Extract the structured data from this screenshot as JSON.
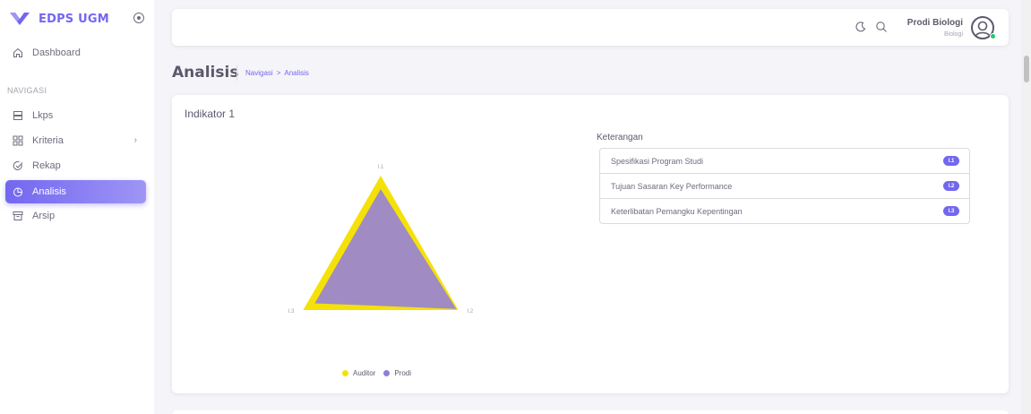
{
  "brand": {
    "name": "EDPS UGM",
    "accent": "#7367f0"
  },
  "sidebar": {
    "top_items": [
      {
        "label": "Dashboard",
        "icon": "home-icon"
      }
    ],
    "nav_heading": "NAVIGASI",
    "items": [
      {
        "label": "Lkps",
        "icon": "list-icon"
      },
      {
        "label": "Kriteria",
        "icon": "grid-icon",
        "has_submenu": true
      },
      {
        "label": "Rekap",
        "icon": "check-circle-icon"
      },
      {
        "label": "Analisis",
        "icon": "pie-chart-icon",
        "active": true
      },
      {
        "label": "Arsip",
        "icon": "archive-icon"
      }
    ]
  },
  "navbar": {
    "icons": [
      "moon-icon",
      "search-icon"
    ],
    "user_name": "Prodi Biologi",
    "user_role": "Biologi",
    "status_color": "#28c76f"
  },
  "page": {
    "title": "Analisis",
    "breadcrumb": [
      "Navigasi",
      ">",
      "Analisis"
    ]
  },
  "card": {
    "title": "Indikator 1",
    "keterangan_title": "Keterangan",
    "keterangan": [
      {
        "label": "Spesifikasi Program Studi",
        "code": "I.1"
      },
      {
        "label": "Tujuan Sasaran Key Performance",
        "code": "I.2"
      },
      {
        "label": "Keterlibatan Pemangku Kepentingan",
        "code": "I.3"
      }
    ]
  },
  "chart_data": {
    "type": "radar",
    "axes": [
      "I.1",
      "I.2",
      "I.3"
    ],
    "scale_max": 4,
    "series": [
      {
        "name": "Auditor",
        "color": "#f5e10a",
        "values": [
          4,
          4,
          4
        ]
      },
      {
        "name": "Prodi",
        "color": "#9b86cc",
        "values": [
          3.4,
          3.9,
          3.4
        ]
      }
    ],
    "legend_position": "bottom"
  }
}
